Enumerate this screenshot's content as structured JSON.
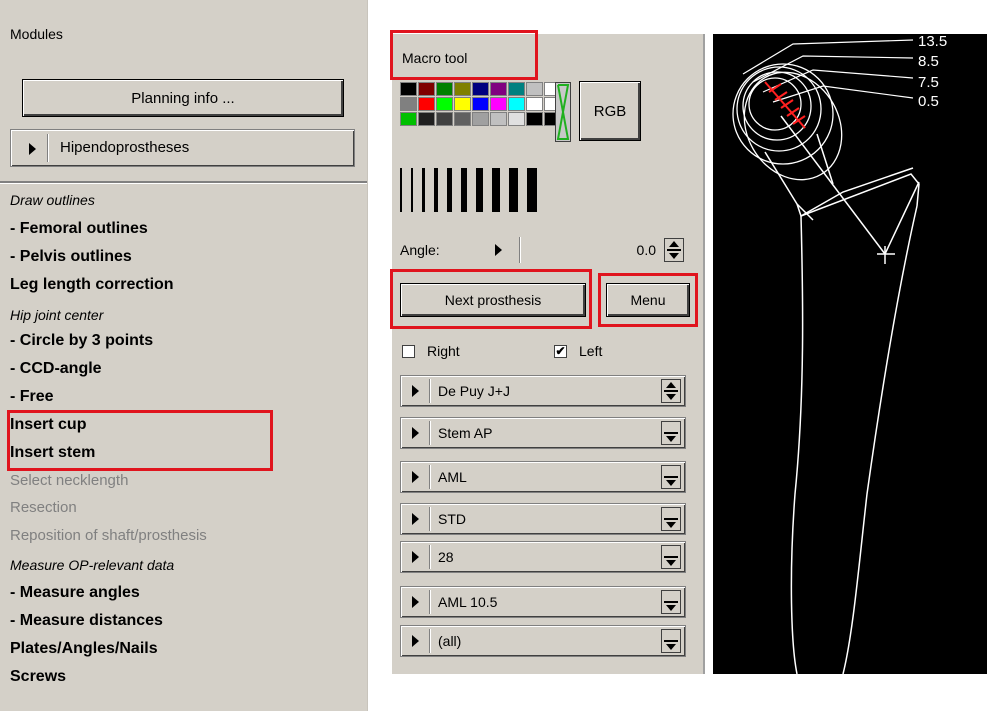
{
  "modules": {
    "title": "Modules",
    "planning_button": "Planning info ...",
    "category_dropdown": "Hipendoprostheses",
    "menu": [
      {
        "label": "Draw outlines",
        "style": "italic"
      },
      {
        "label": " - Femoral outlines",
        "style": "bold"
      },
      {
        "label": " - Pelvis outlines",
        "style": "bold"
      },
      {
        "label": "Leg length correction",
        "style": "bold"
      },
      {
        "label": "Hip joint center",
        "style": "italic"
      },
      {
        "label": " - Circle by 3 points",
        "style": "bold"
      },
      {
        "label": " - CCD-angle",
        "style": "bold"
      },
      {
        "label": " - Free",
        "style": "bold"
      },
      {
        "label": "Insert cup",
        "style": "bold"
      },
      {
        "label": "Insert stem",
        "style": "bold"
      },
      {
        "label": "Select necklength",
        "style": "disabled"
      },
      {
        "label": "Resection",
        "style": "disabled"
      },
      {
        "label": "Reposition of shaft/prosthesis",
        "style": "disabled"
      },
      {
        "label": "Measure OP-relevant data",
        "style": "italic"
      },
      {
        "label": " - Measure angles",
        "style": "bold"
      },
      {
        "label": " - Measure distances",
        "style": "bold"
      },
      {
        "label": "Plates/Angles/Nails",
        "style": "bold"
      },
      {
        "label": "Screws",
        "style": "bold"
      }
    ]
  },
  "tool": {
    "macro_label": "Macro tool",
    "palette_colors": [
      "#000000",
      "#800000",
      "#008000",
      "#808000",
      "#000080",
      "#800080",
      "#008080",
      "#c0c0c0",
      "#ffffff",
      "#808080",
      "#ff0000",
      "#00ff00",
      "#ffff00",
      "#0000ff",
      "#ff00ff",
      "#00ffff",
      "#ffffff",
      "#ffffff",
      "#00c000",
      "#202020",
      "#404040",
      "#606060",
      "#a0a0a0",
      "#c0c0c0",
      "#e0e0e0",
      "#000000",
      "#000000"
    ],
    "rgb_button": "RGB",
    "angle_label": "Angle:",
    "angle_value": "0.0",
    "next_button": "Next prosthesis",
    "menu_button": "Menu",
    "right_label": "Right",
    "right_checked": false,
    "left_label": "Left",
    "left_checked": true,
    "dropdowns": [
      "De Puy  J+J",
      "Stem AP",
      "AML",
      "STD",
      "28",
      "AML 10.5",
      "(all)"
    ]
  },
  "xray": {
    "labels": [
      "13.5",
      "8.5",
      "7.5",
      "0.5"
    ]
  },
  "colors": {
    "highlight": "#e0141e",
    "panel": "#d4d0c8",
    "marker": "#ff2020"
  }
}
